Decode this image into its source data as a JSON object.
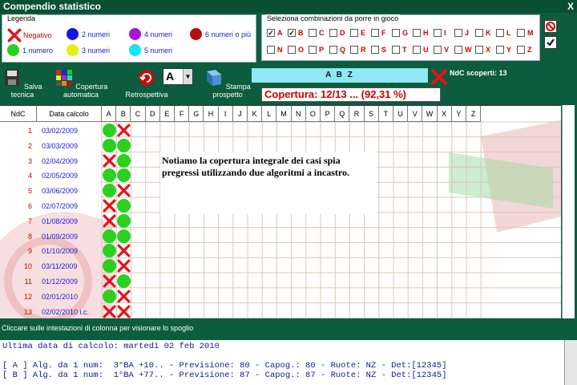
{
  "window": {
    "title": "Compendio statistico",
    "close": "X"
  },
  "legend": {
    "caption": "Legenda",
    "items": [
      {
        "label": "Negativo",
        "color": "#e8101a",
        "kind": "cross"
      },
      {
        "label": "2 numeri",
        "color": "#1616e0",
        "kind": "dot"
      },
      {
        "label": "4 numeri",
        "color": "#a615d8",
        "kind": "dot"
      },
      {
        "label": "6 numeri o più",
        "color": "#b80d0d",
        "kind": "dot"
      },
      {
        "label": "1 numero",
        "color": "#2bd021",
        "kind": "dot"
      },
      {
        "label": "3 numeri",
        "color": "#e4ed1a",
        "kind": "dot"
      },
      {
        "label": "5 numeri",
        "color": "#14e6ef",
        "kind": "dot"
      }
    ]
  },
  "combos": {
    "caption": "Seleziona combinazioni da porre in gioco",
    "row1": [
      {
        "l": "A",
        "c": true
      },
      {
        "l": "B",
        "c": true
      },
      {
        "l": "C",
        "c": false
      },
      {
        "l": "D",
        "c": false
      },
      {
        "l": "E",
        "c": false
      },
      {
        "l": "F",
        "c": false
      },
      {
        "l": "G",
        "c": false
      },
      {
        "l": "H",
        "c": false
      },
      {
        "l": "I",
        "c": false
      },
      {
        "l": "J",
        "c": false
      },
      {
        "l": "K",
        "c": false
      },
      {
        "l": "L",
        "c": false
      },
      {
        "l": "M",
        "c": false
      }
    ],
    "row2": [
      {
        "l": "N",
        "c": false
      },
      {
        "l": "O",
        "c": false
      },
      {
        "l": "P",
        "c": false
      },
      {
        "l": "Q",
        "c": false
      },
      {
        "l": "R",
        "c": false
      },
      {
        "l": "S",
        "c": false
      },
      {
        "l": "T",
        "c": false
      },
      {
        "l": "U",
        "c": false
      },
      {
        "l": "V",
        "c": false
      },
      {
        "l": "W",
        "c": false
      },
      {
        "l": "X",
        "c": false
      },
      {
        "l": "Y",
        "c": false
      },
      {
        "l": "Z",
        "c": false
      }
    ]
  },
  "toolbar": {
    "salva": "Salva tecnica",
    "copertura": "Copertura automatica",
    "retro": "Retrospettiva",
    "select_value": "A",
    "stampa": "Stampa prospetto"
  },
  "selected_combo": "A B Z",
  "ndc_scoperti": "NdC scoperti: 13",
  "copertura": "Copertura: 12/13 ... (92,31 %)",
  "grid": {
    "header_ndc": "NdC",
    "header_date": "Data calcolo",
    "columns": [
      "A",
      "B",
      "C",
      "D",
      "E",
      "F",
      "G",
      "H",
      "I",
      "J",
      "K",
      "L",
      "M",
      "N",
      "O",
      "P",
      "Q",
      "R",
      "S",
      "T",
      "U",
      "V",
      "W",
      "X",
      "Y",
      "Z"
    ],
    "rows": [
      {
        "n": "1",
        "d": "03/02/2009",
        "a": "g",
        "b": "x"
      },
      {
        "n": "2",
        "d": "03/03/2009",
        "a": "g",
        "b": "g"
      },
      {
        "n": "3",
        "d": "02/04/2009",
        "a": "x",
        "b": "g"
      },
      {
        "n": "4",
        "d": "02/05/2009",
        "a": "g",
        "b": "g"
      },
      {
        "n": "5",
        "d": "03/06/2009",
        "a": "g",
        "b": "x"
      },
      {
        "n": "6",
        "d": "02/07/2009",
        "a": "x",
        "b": "g"
      },
      {
        "n": "7",
        "d": "01/08/2009",
        "a": "x",
        "b": "g"
      },
      {
        "n": "8",
        "d": "01/09/2009",
        "a": "g",
        "b": "g"
      },
      {
        "n": "9",
        "d": "01/10/2009",
        "a": "g",
        "b": "x"
      },
      {
        "n": "10",
        "d": "03/11/2009",
        "a": "g",
        "b": "x"
      },
      {
        "n": "11",
        "d": "01/12/2009",
        "a": "x",
        "b": "g"
      },
      {
        "n": "12",
        "d": "02/01/2010",
        "a": "g",
        "b": "x"
      },
      {
        "n": "13",
        "d": "02/02/2010 i.c.",
        "a": "x",
        "b": "x"
      }
    ]
  },
  "note": "Notiamo la copertura integrale dei casi spia pregressi  utilizzando due algoritmi a incastro.",
  "hint": "Cliccare sulle intestazioni di colonna per visionare lo spoglio",
  "log": [
    "Ultima data di calcolo: martedì 02 feb 2010",
    "",
    "[ A ] Alg. da 1 num:  3°BA +10.. - Previsione: 80 - Capog.: 80 - Ruote: NZ - Det:[12345]",
    "[ B ] Alg. da 1 num:  1°BA +77.. - Previsione: 87 - Capog.: 87 - Ruote: NZ - Det:[12345]"
  ]
}
